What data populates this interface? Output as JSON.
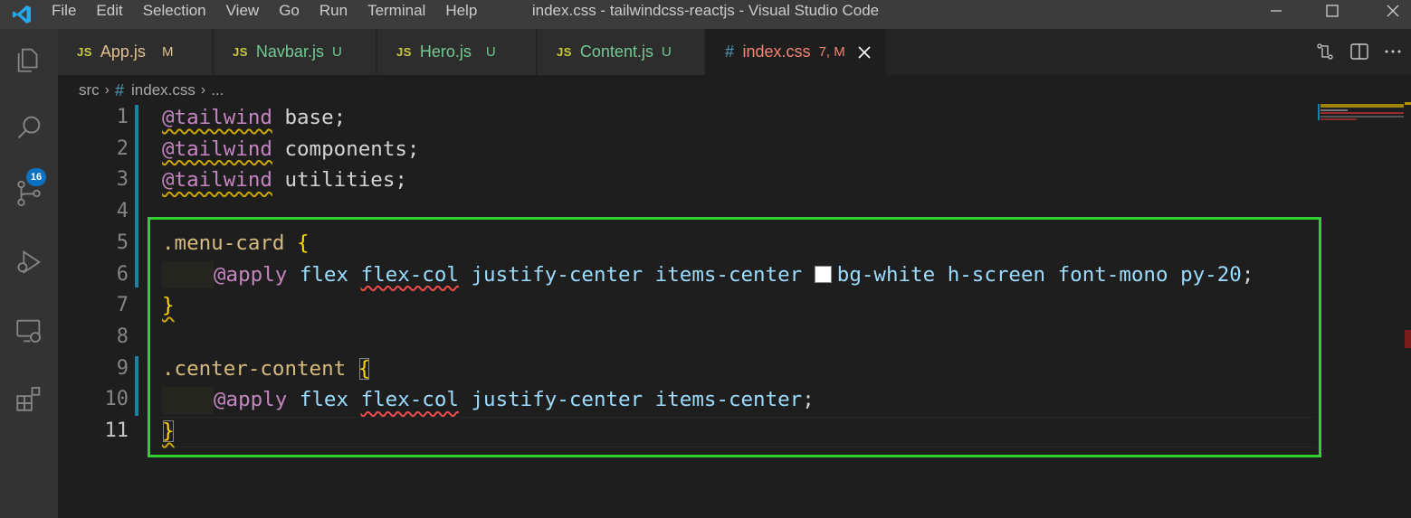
{
  "titlebar": {
    "menu": [
      "File",
      "Edit",
      "Selection",
      "View",
      "Go",
      "Run",
      "Terminal",
      "Help"
    ],
    "title": "index.css - tailwindcss-reactjs - Visual Studio Code"
  },
  "activitybar": {
    "icons": [
      "explorer-icon",
      "search-icon",
      "source-control-icon",
      "run-debug-icon",
      "remote-explorer-icon",
      "extensions-icon"
    ],
    "source_control_badge": "16"
  },
  "tabs": [
    {
      "type": "JS",
      "name": "App.js",
      "status": "M",
      "state": "modified",
      "active": false
    },
    {
      "type": "JS",
      "name": "Navbar.js",
      "status": "U",
      "state": "untracked",
      "active": false
    },
    {
      "type": "JS",
      "name": "Hero.js",
      "status": "U",
      "state": "untracked",
      "active": false
    },
    {
      "type": "JS",
      "name": "Content.js",
      "status": "U",
      "state": "untracked",
      "active": false
    },
    {
      "type": "#",
      "name": "index.css",
      "status": "7, M",
      "state": "error",
      "active": true
    }
  ],
  "breadcrumb": {
    "folder": "src",
    "file": "index.css",
    "more": "..."
  },
  "editor": {
    "current_line": "11",
    "lines": [
      {
        "n": "1",
        "at": "@tailwind",
        "rest": " base;"
      },
      {
        "n": "2",
        "at": "@tailwind",
        "rest": " components;"
      },
      {
        "n": "3",
        "at": "@tailwind",
        "rest": " utilities;"
      },
      {
        "n": "4"
      },
      {
        "n": "5",
        "selector": ".menu-card",
        "brace": "{"
      },
      {
        "n": "6",
        "apply": "@apply",
        "v1": "flex",
        "v2": "flex-col",
        "v3": "justify-center items-center",
        "v4": "bg-white h-screen font-mono py-20",
        "end": ";"
      },
      {
        "n": "7",
        "brace": "}"
      },
      {
        "n": "8"
      },
      {
        "n": "9",
        "selector": ".center-content",
        "brace": "{"
      },
      {
        "n": "10",
        "apply": "@apply",
        "v1": "flex",
        "v2": "flex-col",
        "v3": "justify-center items-center",
        "end": ";"
      },
      {
        "n": "11",
        "brace": "}"
      }
    ]
  },
  "colors": {
    "highlight_box": "#2fd12f",
    "accent": "#0e70c0"
  }
}
